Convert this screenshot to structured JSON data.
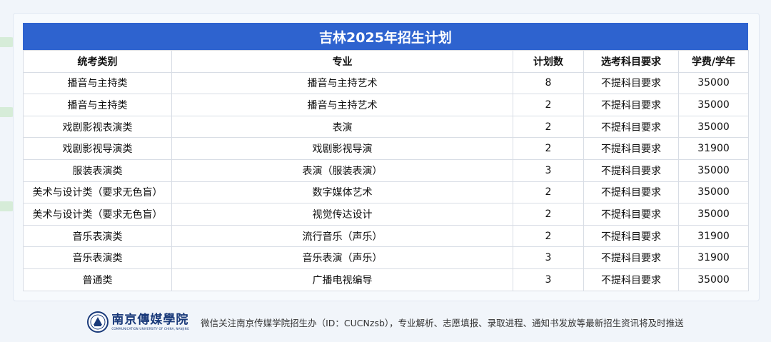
{
  "title": "吉林2025年招生计划",
  "table": {
    "headers": [
      "统考类别",
      "专业",
      "计划数",
      "选考科目要求",
      "学费/学年"
    ],
    "rows": [
      [
        "播音与主持类",
        "播音与主持艺术",
        "8",
        "不提科目要求",
        "35000"
      ],
      [
        "播音与主持类",
        "播音与主持艺术",
        "2",
        "不提科目要求",
        "35000"
      ],
      [
        "戏剧影视表演类",
        "表演",
        "2",
        "不提科目要求",
        "35000"
      ],
      [
        "戏剧影视导演类",
        "戏剧影视导演",
        "2",
        "不提科目要求",
        "31900"
      ],
      [
        "服装表演类",
        "表演（服装表演）",
        "3",
        "不提科目要求",
        "35000"
      ],
      [
        "美术与设计类（要求无色盲）",
        "数字媒体艺术",
        "2",
        "不提科目要求",
        "35000"
      ],
      [
        "美术与设计类（要求无色盲）",
        "视觉传达设计",
        "2",
        "不提科目要求",
        "35000"
      ],
      [
        "音乐表演类",
        "流行音乐（声乐）",
        "2",
        "不提科目要求",
        "31900"
      ],
      [
        "音乐表演类",
        "音乐表演（声乐）",
        "3",
        "不提科目要求",
        "31900"
      ],
      [
        "普通类",
        "广播电视编导",
        "3",
        "不提科目要求",
        "35000"
      ]
    ]
  },
  "footer": {
    "logo_cn": "南京傳媒學院",
    "logo_en": "COMMUNICATION UNIVERSITY OF CHINA, NANJING",
    "note": "微信关注南京传媒学院招生办（ID：CUCNzsb），专业解析、志愿填报、录取进程、通知书发放等最新招生资讯将及时推送"
  },
  "colors": {
    "header_blue": "#2e63cf",
    "background": "#f1f5fa",
    "logo_navy": "#1a3a7a"
  }
}
